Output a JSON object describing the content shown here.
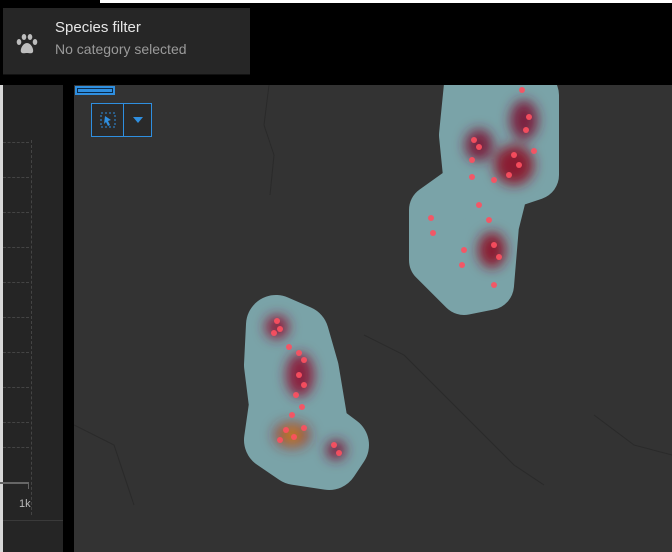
{
  "filter_card": {
    "title": "Species filter",
    "subtitle": "No category selected",
    "icon": "paw-icon"
  },
  "chart_panel": {
    "axis_tick": "1k"
  },
  "map_tools": {
    "select_icon": "lasso-select-icon",
    "dropdown_icon": "chevron-down-icon"
  },
  "colors": {
    "accent": "#2f8fe0",
    "map_bg": "#333333",
    "panel_bg": "#252525"
  }
}
